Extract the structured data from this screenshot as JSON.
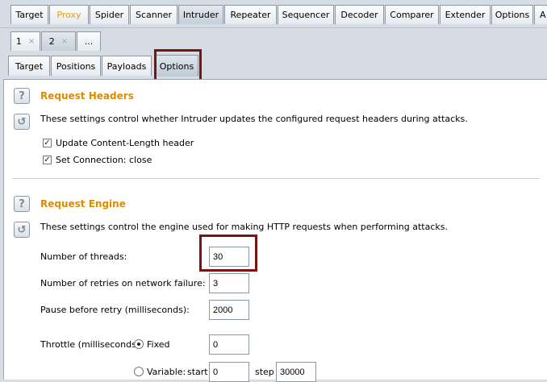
{
  "main_tabs": [
    "Target",
    "Proxy",
    "Spider",
    "Scanner",
    "Intruder",
    "Repeater",
    "Sequencer",
    "Decoder",
    "Comparer",
    "Extender",
    "Options",
    "A"
  ],
  "session_tabs": {
    "tab1": "1",
    "tab2": "2",
    "close_glyph": "×",
    "more": "..."
  },
  "sub_tabs": [
    "Target",
    "Positions",
    "Payloads",
    "Options"
  ],
  "request_headers": {
    "title": "Request Headers",
    "description": "These settings control whether Intruder updates the configured request headers during attacks.",
    "update_content_length_label": "Update Content-Length header",
    "update_content_length_checked": true,
    "set_connection_label": "Set Connection: close",
    "set_connection_checked": true
  },
  "request_engine": {
    "title": "Request Engine",
    "description": "These settings control the engine used for making HTTP requests when performing attacks.",
    "threads_label": "Number of threads:",
    "threads_value": "30",
    "retries_label": "Number of retries on network failure:",
    "retries_value": "3",
    "pause_label": "Pause before retry (milliseconds):",
    "pause_value": "2000",
    "throttle_label": "Throttle (milliseconds):",
    "fixed_label": "Fixed",
    "fixed_value": "0",
    "variable_label": "Variable:",
    "start_label": "start",
    "start_value": "0",
    "step_label": "step",
    "step_value": "30000"
  },
  "icons": {
    "help": "?",
    "restore": "↺",
    "check": "✓"
  },
  "colors": {
    "section_title": "#e08a00",
    "highlight": "#7a1410",
    "proxy_tab_text": "#e0a020"
  }
}
